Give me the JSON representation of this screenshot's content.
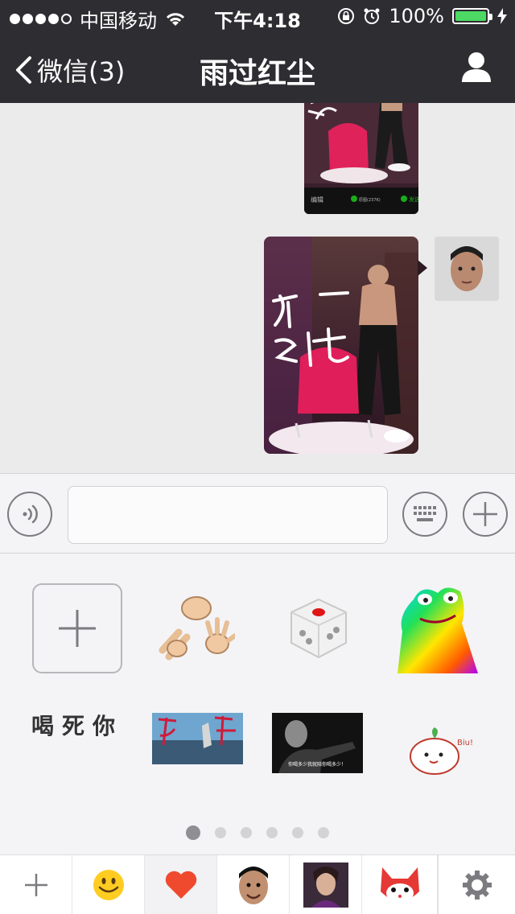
{
  "status_bar": {
    "carrier": "中国移动",
    "time": "下午4:18",
    "battery_percent": "100%"
  },
  "nav": {
    "back_label": "微信(3)",
    "title": "雨过红尘"
  },
  "messages": {
    "image_1_texts": [
      "编辑",
      "原图(237K)",
      "发送"
    ],
    "image_2_caption": "再一战"
  },
  "input_bar": {
    "placeholder": ""
  },
  "emoji_panel": {
    "text_sticker": "喝死你",
    "sticker_caption_4": "你喝多少我就陪你喝多少！",
    "sticker_caption_6": "Biu!",
    "page_count": 6,
    "current_page": 1
  },
  "colors": {
    "nav_bg": "#2e2e32",
    "battery_green": "#4cd964",
    "panel_bg": "#f4f4f6"
  }
}
